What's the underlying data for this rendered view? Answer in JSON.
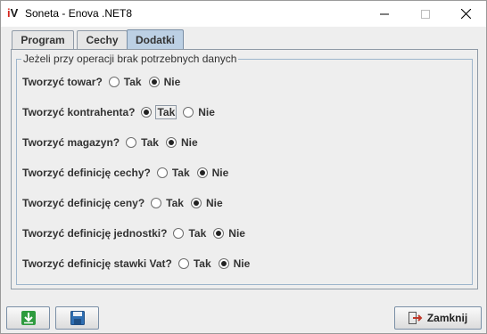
{
  "window": {
    "title": "Soneta - Enova .NET8",
    "logo_i": "i",
    "logo_v": "V"
  },
  "tabs": [
    {
      "label": "Program",
      "selected": false
    },
    {
      "label": "Cechy",
      "selected": false
    },
    {
      "label": "Dodatki",
      "selected": true
    }
  ],
  "group": {
    "legend": "Jeżeli przy operacji brak potrzebnych danych"
  },
  "options": {
    "yes": "Tak",
    "no": "Nie"
  },
  "rows": [
    {
      "question": "Tworzyć towar?",
      "selected": "no"
    },
    {
      "question": "Tworzyć kontrahenta?",
      "selected": "yes"
    },
    {
      "question": "Tworzyć magazyn?",
      "selected": "no"
    },
    {
      "question": "Tworzyć definicję cechy?",
      "selected": "no"
    },
    {
      "question": "Tworzyć definicję ceny?",
      "selected": "no"
    },
    {
      "question": "Tworzyć definicję jednostki?",
      "selected": "no"
    },
    {
      "question": "Tworzyć definicję stawki Vat?",
      "selected": "no"
    }
  ],
  "buttons": {
    "close_label": "Zamknij"
  },
  "icons": {
    "import": "download-arrow-icon",
    "save": "floppy-disk-icon",
    "close": "exit-door-icon"
  },
  "colors": {
    "active_tab": "#bcd0e4",
    "group_border": "#9db5cc",
    "import_icon": "#2e9b3e",
    "save_icon": "#2f6fb3",
    "close_icon": "#c0392b"
  }
}
